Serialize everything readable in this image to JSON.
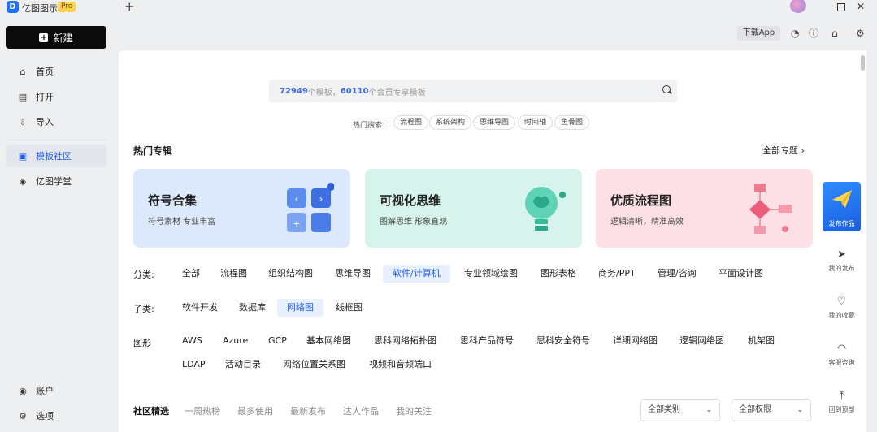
{
  "app": {
    "name": "亿图图示",
    "badge": "Pro"
  },
  "titlebar": {
    "new_tab": "+",
    "close": "✕"
  },
  "sidebar": {
    "new_label": "新建",
    "items": [
      {
        "label": "首页",
        "icon": "home-icon",
        "glyph": "⌂"
      },
      {
        "label": "打开",
        "icon": "file-icon",
        "glyph": "▤"
      },
      {
        "label": "导入",
        "icon": "import-icon",
        "glyph": "⇩"
      },
      {
        "label": "模板社区",
        "icon": "community-icon",
        "glyph": "▣"
      },
      {
        "label": "亿图学堂",
        "icon": "school-icon",
        "glyph": "◈"
      }
    ],
    "bottom": [
      {
        "label": "账户",
        "icon": "account-icon",
        "glyph": "◉"
      },
      {
        "label": "选项",
        "icon": "settings-icon",
        "glyph": "⚙"
      }
    ]
  },
  "toolbar": {
    "download_app": "下载App"
  },
  "search": {
    "count_templates": "72949",
    "text_templates": "个模板，",
    "count_member": "60110",
    "text_member": "个会员专享模板"
  },
  "hot_search": {
    "label": "热门搜索：",
    "chips": [
      "流程图",
      "系统架构",
      "思维导图",
      "时间轴",
      "鱼骨图"
    ]
  },
  "hot_topics": {
    "title": "热门专辑",
    "all_label": "全部专题 ›",
    "cards": [
      {
        "title": "符号合集",
        "subtitle": "符号素材 专业丰富"
      },
      {
        "title": "可视化思维",
        "subtitle": "图解思维 形象直观"
      },
      {
        "title": "优质流程图",
        "subtitle": "逻辑清晰，精准高效"
      }
    ]
  },
  "categories": {
    "label": "分类:",
    "items": [
      "全部",
      "流程图",
      "组织结构图",
      "思维导图",
      "软件/计算机",
      "专业领域绘图",
      "图形表格",
      "商务/PPT",
      "管理/咨询",
      "平面设计图"
    ],
    "selected": "软件/计算机"
  },
  "subcategories": {
    "label": "子类:",
    "items": [
      "软件开发",
      "数据库",
      "网络图",
      "线框图"
    ],
    "selected": "网络图"
  },
  "shapes": {
    "label": "图形",
    "row1": [
      "AWS",
      "Azure",
      "GCP",
      "基本网络图",
      "思科网络拓扑图",
      "思科产品符号",
      "思科安全符号",
      "详细网络图",
      "逻辑网络图",
      "机架图"
    ],
    "row2": [
      "LDAP",
      "活动目录",
      "网络位置关系图",
      "视频和音频端口"
    ]
  },
  "community_tabs": {
    "items": [
      "社区精选",
      "一周热榜",
      "最多使用",
      "最新发布",
      "达人作品",
      "我的关注"
    ],
    "active": "社区精选"
  },
  "filters": {
    "category": "全部类别",
    "permission": "全部权限"
  },
  "right_panel": {
    "publish": "发布作品",
    "tools": [
      {
        "label": "我的发布",
        "icon": "send-icon",
        "glyph": "➤"
      },
      {
        "label": "我的收藏",
        "icon": "heart-icon",
        "glyph": "♡"
      },
      {
        "label": "客服咨询",
        "icon": "headset-icon",
        "glyph": "◠"
      },
      {
        "label": "回到顶部",
        "icon": "top-icon",
        "glyph": "⤒"
      }
    ]
  }
}
